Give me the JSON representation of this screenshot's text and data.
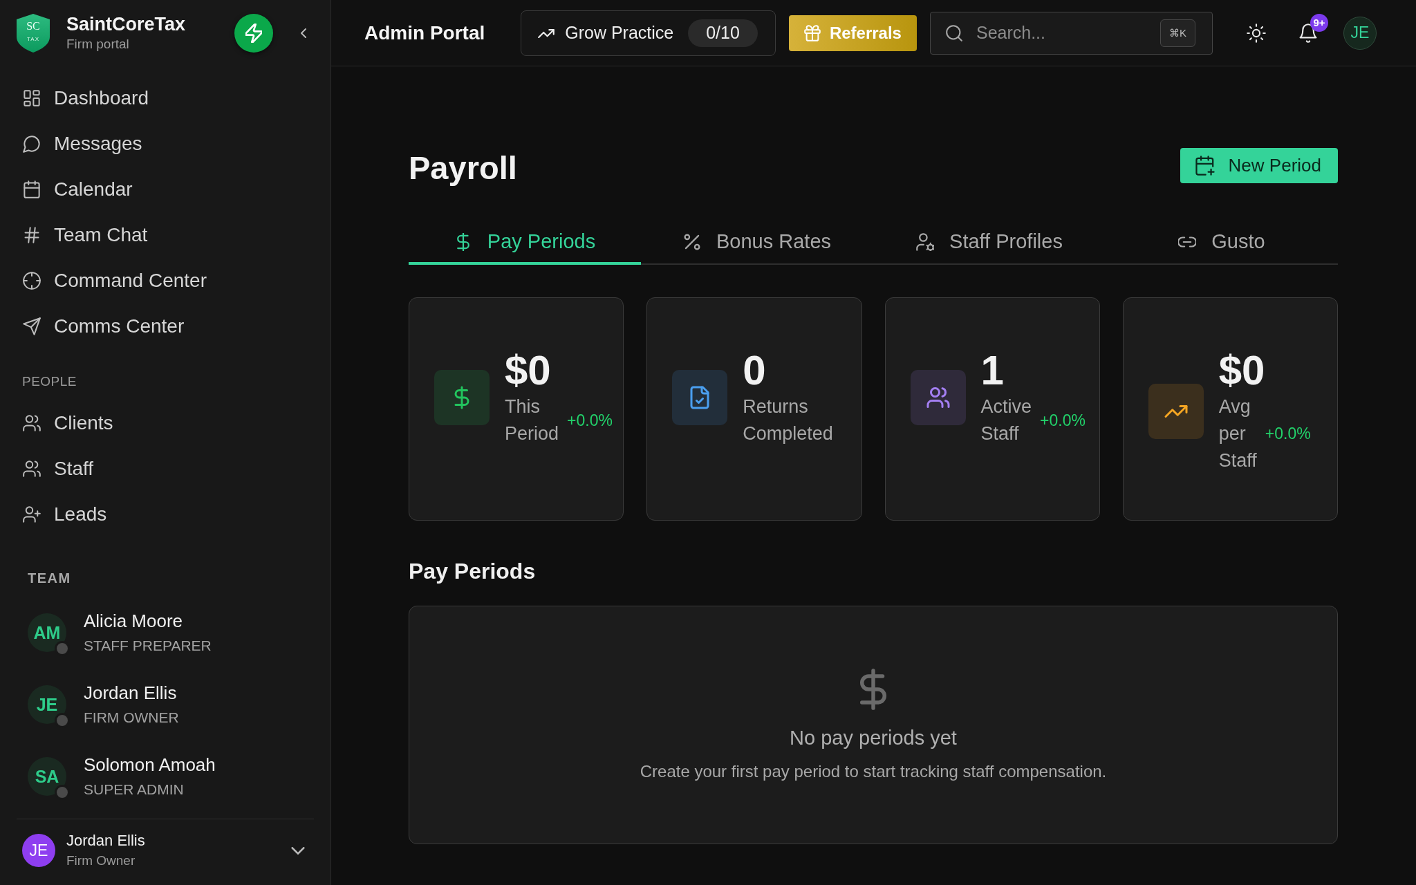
{
  "sidebar": {
    "logo": {
      "initials": "SC",
      "caption": "TAX"
    },
    "brand": "SaintCoreTax",
    "subtitle": "Firm portal",
    "nav": [
      {
        "label": "Dashboard",
        "selected": false
      },
      {
        "label": "Messages",
        "selected": false
      },
      {
        "label": "Calendar",
        "selected": false
      },
      {
        "label": "Team Chat",
        "selected": false
      },
      {
        "label": "Command Center",
        "selected": false
      },
      {
        "label": "Comms Center",
        "selected": false
      }
    ],
    "people": {
      "heading": "PEOPLE",
      "items": [
        {
          "label": "Clients",
          "selected": false
        },
        {
          "label": "Staff",
          "selected": false
        },
        {
          "label": "Leads",
          "selected": false
        }
      ]
    },
    "team": {
      "heading": "TEAM",
      "members": [
        {
          "initials": "AM",
          "name": "Alicia Moore",
          "role": "STAFF PREPARER",
          "online": false
        },
        {
          "initials": "JE",
          "name": "Jordan Ellis",
          "role": "FIRM OWNER",
          "online": false
        },
        {
          "initials": "SA",
          "name": "Solomon Amoah",
          "role": "SUPER ADMIN",
          "online": false
        }
      ]
    },
    "user": {
      "initials": "JE",
      "name": "Jordan Ellis",
      "role": "Firm Owner"
    }
  },
  "header": {
    "title": "Admin Portal",
    "grow": {
      "label": "Grow Practice",
      "progress": "0/10"
    },
    "referrals": "Referrals",
    "search": {
      "placeholder": "Search...",
      "shortcut": "⌘K"
    },
    "notifications": "9+",
    "avatar": "JE"
  },
  "page": {
    "title": "Payroll",
    "new_button": "New Period",
    "tabs": [
      {
        "label": "Pay Periods",
        "selected": true
      },
      {
        "label": "Bonus Rates",
        "selected": false
      },
      {
        "label": "Staff Profiles",
        "selected": false
      },
      {
        "label": "Gusto",
        "selected": false
      }
    ],
    "stats": [
      {
        "value": "$0",
        "label": "This Period",
        "change": "+0.0%",
        "color": "#22c55e"
      },
      {
        "value": "0",
        "label": "Returns Completed",
        "color": "#4a9ff0"
      },
      {
        "value": "1",
        "label": "Active Staff",
        "change": "+0.0%",
        "color": "#a47ff2"
      },
      {
        "value": "$0",
        "label": "Avg per Staff",
        "change": "+0.0%",
        "color": "#f5a623"
      }
    ],
    "section_title": "Pay Periods",
    "empty": {
      "title": "No pay periods yet",
      "text": "Create your first pay period to start tracking staff compensation."
    }
  }
}
